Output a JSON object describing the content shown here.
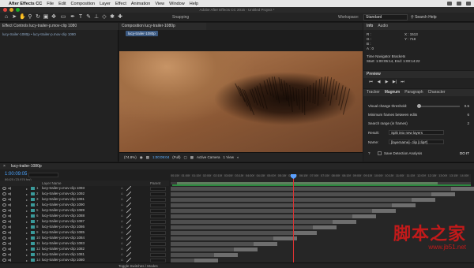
{
  "menubar": {
    "apple": "",
    "app": "After Effects CC",
    "items": [
      "File",
      "Edit",
      "Composition",
      "Layer",
      "Effect",
      "Animation",
      "View",
      "Window",
      "Help"
    ]
  },
  "window": {
    "title": "Adobe After Effects CC 2015 - Untitled Project *"
  },
  "toolbar": {
    "snapping": "Snapping",
    "workspace_label": "Workspace:",
    "workspace_value": "Standard",
    "search_help": "Search Help"
  },
  "effect_panel": {
    "tab": "Effect Controls lucy-trailer-p.mov-clip 1080",
    "sub": "lucy-trailer-1080p • lucy-trailer-p.mov-clip 1080"
  },
  "comp_panel": {
    "tab": "Composition lucy-trailer-1080p",
    "chip": "lucy-trailer-1080p",
    "zoom": "(74.8%)",
    "timecode": "1:00:09:04",
    "resolution": "(Full)",
    "camera": "Active Camera",
    "views": "1 View"
  },
  "info_panel": {
    "tabs": [
      "Info",
      "Audio"
    ],
    "r": "R :",
    "g": "G :",
    "b": "B :",
    "a": "A : 0",
    "x": "X : 1513",
    "y": "Y : 718",
    "nav": "Time Navigator Brackets",
    "range": "Start: 1:00:05:14, End: 1:00:14:22"
  },
  "preview_panel": {
    "tab": "Preview"
  },
  "magnum_panel": {
    "tabs": [
      "Tracker",
      "Magnum",
      "Paragraph",
      "Character"
    ],
    "threshold_label": "Visual change threshold:",
    "threshold_value": "0.5",
    "min_frames_label": "Minimum frames between edits",
    "min_frames_value": "6",
    "search_range_label": "Search range (in frames)",
    "search_range_value": "2",
    "result_label": "Result:",
    "result_value": "Split into new layers",
    "name_label": "Name:",
    "name_value": "[layername]- clip [clip#]",
    "detect_label": "Save Detection Analysis",
    "go": "DO IT"
  },
  "timeline": {
    "tab": "lucy-trailer-1080p",
    "timecode": "1:00:09:05",
    "fps": "86425 (23.976 fps)",
    "col_layer_name": "Layer Name",
    "col_parent": "Parent",
    "toggle": "Toggle Switches / Modes",
    "ticks": [
      "00:15f",
      "01:00f",
      "01:15f",
      "02:00f",
      "02:15f",
      "03:00f",
      "03:15f",
      "04:00f",
      "04:15f",
      "05:00f",
      "05:15f",
      "06:00f",
      "06:15f",
      "07:00f",
      "07:15f",
      "08:00f",
      "08:15f",
      "09:00f",
      "09:15f",
      "10:00f",
      "10:15f",
      "11:00f",
      "11:15f",
      "12:00f",
      "12:15f",
      "13:00f",
      "13:15f",
      "14:00f"
    ],
    "layers": [
      {
        "num": "1",
        "name": "lucy-trailer-p.mov-clip 1093",
        "parent": "None"
      },
      {
        "num": "2",
        "name": "lucy-trailer-p.mov-clip 1092",
        "parent": "None"
      },
      {
        "num": "3",
        "name": "lucy-trailer-p.mov-clip 1091",
        "parent": "None"
      },
      {
        "num": "4",
        "name": "lucy-trailer-p.mov-clip 1090",
        "parent": "None"
      },
      {
        "num": "5",
        "name": "lucy-trailer-p.mov-clip 1089",
        "parent": "None"
      },
      {
        "num": "6",
        "name": "lucy-trailer-p.mov-clip 1088",
        "parent": "None"
      },
      {
        "num": "7",
        "name": "lucy-trailer-p.mov-clip 1087",
        "parent": "None"
      },
      {
        "num": "8",
        "name": "lucy-trailer-p.mov-clip 1086",
        "parent": "None"
      },
      {
        "num": "9",
        "name": "lucy-trailer-p.mov-clip 1085",
        "parent": "None"
      },
      {
        "num": "10",
        "name": "lucy-trailer-p.mov-clip 1084",
        "parent": "None"
      },
      {
        "num": "11",
        "name": "lucy-trailer-p.mov-clip 1083",
        "parent": "None"
      },
      {
        "num": "12",
        "name": "lucy-trailer-p.mov-clip 1082",
        "parent": "None"
      },
      {
        "num": "13",
        "name": "lucy-trailer-p.mov-clip 1081",
        "parent": "None"
      },
      {
        "num": "14",
        "name": "lucy-trailer-p.mov-clip 1080",
        "parent": "None"
      }
    ]
  },
  "watermark": {
    "title": "脚本之家",
    "url": "www.jb51.net"
  }
}
